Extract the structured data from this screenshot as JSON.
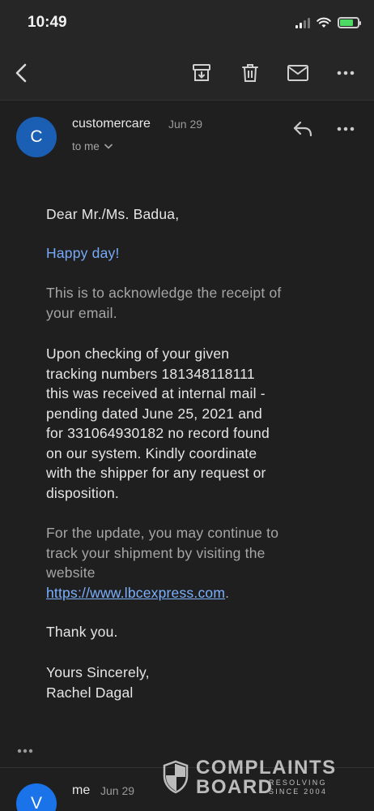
{
  "status_bar": {
    "time": "10:49"
  },
  "message": {
    "sender_initial": "C",
    "sender": "customercare",
    "date": "Jun 29",
    "recipient": "to me",
    "body": {
      "greeting": "Dear Mr./Ms. Badua,",
      "happy": "Happy day!",
      "ack_line1": "This is to acknowledge the receipt of",
      "ack_line2": "your email.",
      "p3_line1": "Upon checking of your given",
      "p3_line2": "tracking numbers 181348118111",
      "p3_line3": "this was received at internal mail -",
      "p3_line4": "pending dated June 25, 2021 and",
      "p3_line5": "for 331064930182 no record found",
      "p3_line6": "on our system. Kindly coordinate",
      "p3_line7": "with the shipper for any request or",
      "p3_line8": "disposition.",
      "p4_line1": "For the update, you may continue to",
      "p4_line2": "track your shipment by visiting the",
      "p4_line3": "website",
      "link": "https://www.lbcexpress.com",
      "link_suffix": ".",
      "thanks": "Thank you.",
      "closing": "Yours Sincerely,",
      "signature": "Rachel Dagal"
    }
  },
  "next_message": {
    "sender_initial": "V",
    "sender": "me",
    "date": "Jun 29"
  },
  "watermark": {
    "line1": "COMPLAINTS",
    "line2": "BOARD",
    "line3a": "RESOLVING",
    "line3b": "SINCE 2004"
  },
  "colors": {
    "background": "#1f1f1f",
    "avatar_c": "#1a5fb4",
    "link": "#7ab0ff",
    "happy_text": "#78a9f6"
  },
  "icons": [
    "back-arrow-icon",
    "archive-icon",
    "trash-icon",
    "mail-icon",
    "more-icon",
    "reply-icon",
    "chevron-down-icon"
  ]
}
